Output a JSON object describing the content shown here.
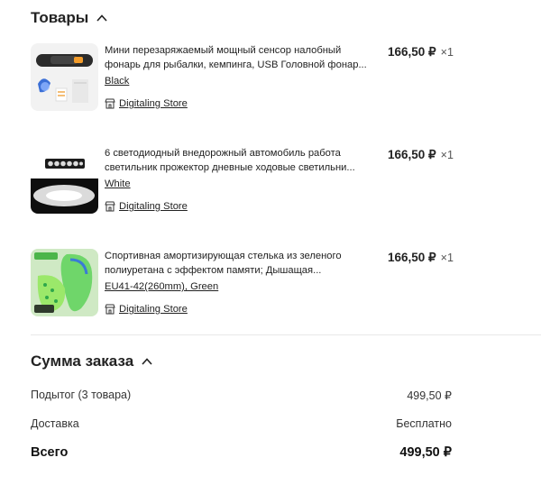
{
  "products_section": {
    "title": "Товары"
  },
  "products": [
    {
      "title_line1": "Мини перезаряжаемый мощный сенсор налобный",
      "title_line2": "фонарь для рыбалки, кемпинга, USB Головной фонар...",
      "variant": "Black",
      "store": "Digitaling Store",
      "price": "166,50 ₽",
      "qty": "×1"
    },
    {
      "title_line1": "6 светодиодный внедорожный автомобиль работа",
      "title_line2": "светильник прожектор дневные ходовые светильни...",
      "variant": "White",
      "store": "Digitaling Store",
      "price": "166,50 ₽",
      "qty": "×1"
    },
    {
      "title_line1": "Спортивная амортизирующая стелька из зеленого",
      "title_line2": "полиуретана с эффектом памяти; Дышащая...",
      "variant": "EU41-42(260mm), Green",
      "store": "Digitaling Store",
      "price": "166,50 ₽",
      "qty": "×1"
    }
  ],
  "summary": {
    "title": "Сумма заказа",
    "subtotal_label": "Подытог (3 товара)",
    "subtotal_value": "499,50 ₽",
    "shipping_label": "Доставка",
    "shipping_value": "Бесплатно",
    "total_label": "Всего",
    "total_value": "499,50 ₽"
  }
}
